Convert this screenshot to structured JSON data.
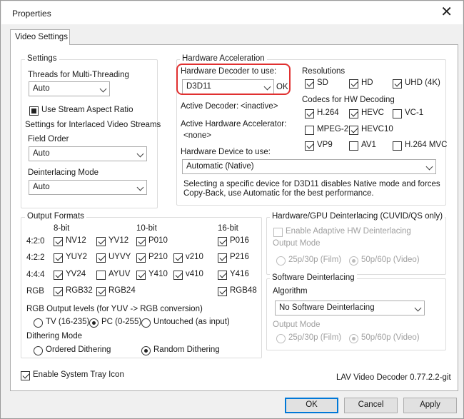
{
  "window": {
    "title": "Properties",
    "close_label": "✕"
  },
  "tab": {
    "label": "Video Settings"
  },
  "settings": {
    "legend": "Settings",
    "threads_label": "Threads for Multi-Threading",
    "threads_value": "Auto",
    "stream_aspect_label": "Use Stream Aspect Ratio",
    "interlaced_label": "Settings for Interlaced Video Streams",
    "field_order_label": "Field Order",
    "field_order_value": "Auto",
    "deint_mode_label": "Deinterlacing Mode",
    "deint_mode_value": "Auto"
  },
  "hwaccel": {
    "legend": "Hardware Acceleration",
    "decoder_label": "Hardware Decoder to use:",
    "decoder_value": "D3D11",
    "decoder_status": "OK",
    "active_decoder_label": "Active Decoder:",
    "active_decoder_value": "<inactive>",
    "active_accel_label": "Active Hardware Accelerator:",
    "active_accel_value": "<none>",
    "device_label": "Hardware Device to use:",
    "device_value": "Automatic (Native)",
    "note_line1": "Selecting a specific device for D3D11 disables Native mode and forces",
    "note_line2": "Copy-Back, use Automatic for the best performance.",
    "resolutions_label": "Resolutions",
    "res_sd": "SD",
    "res_hd": "HD",
    "res_uhd": "UHD (4K)",
    "codecs_label": "Codecs for HW Decoding",
    "codec_h264": "H.264",
    "codec_hevc": "HEVC",
    "codec_vc1": "VC-1",
    "codec_mpeg2": "MPEG-2",
    "codec_hevc10": "HEVC10",
    "codec_vp9": "VP9",
    "codec_av1": "AV1",
    "codec_h264mvc": "H.264 MVC"
  },
  "output": {
    "legend": "Output Formats",
    "col_8bit": "8-bit",
    "col_10bit": "10-bit",
    "col_16bit": "16-bit",
    "row_420": "4:2:0",
    "row_422": "4:2:2",
    "row_444": "4:4:4",
    "row_rgb": "RGB",
    "nv12": "NV12",
    "yv12": "YV12",
    "p010": "P010",
    "p016": "P016",
    "yuy2": "YUY2",
    "uyvy": "UYVY",
    "p210": "P210",
    "v210": "v210",
    "p216": "P216",
    "yv24": "YV24",
    "ayuv": "AYUV",
    "y410": "Y410",
    "v410": "v410",
    "y416": "Y416",
    "rgb32": "RGB32",
    "rgb24": "RGB24",
    "rgb48": "RGB48",
    "levels_label": "RGB Output levels (for YUV -> RGB conversion)",
    "level_tv": "TV (16-235)",
    "level_pc": "PC (0-255)",
    "level_untouched": "Untouched (as input)",
    "dither_label": "Dithering Mode",
    "dither_ordered": "Ordered Dithering",
    "dither_random": "Random Dithering"
  },
  "hwdeint": {
    "legend": "Hardware/GPU Deinterlacing (CUVID/QS only)",
    "enable_label": "Enable Adaptive HW Deinterlacing",
    "output_mode_label": "Output Mode",
    "mode_film": "25p/30p (Film)",
    "mode_video": "50p/60p (Video)"
  },
  "swdeint": {
    "legend": "Software Deinterlacing",
    "algorithm_label": "Algorithm",
    "algorithm_value": "No Software Deinterlacing",
    "output_mode_label": "Output Mode",
    "mode_film": "25p/30p (Film)",
    "mode_video": "50p/60p (Video)"
  },
  "footer": {
    "tray_label": "Enable System Tray Icon",
    "version": "LAV Video Decoder 0.77.2.2-git",
    "ok": "OK",
    "cancel": "Cancel",
    "apply": "Apply"
  },
  "colors": {
    "highlight": "#e03030",
    "focus": "#0078d7"
  }
}
